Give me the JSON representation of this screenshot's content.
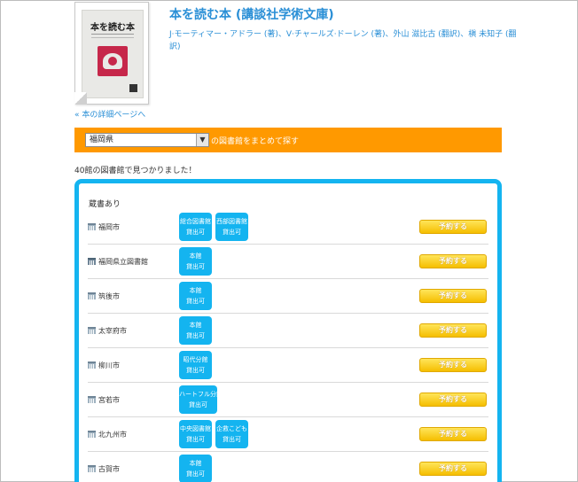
{
  "book": {
    "title": "本を読む本 (講談社学術文庫)",
    "authors": "J·モーティマー・アドラー (著)、V·チャールズ·ドーレン (著)、外山 滋比古 (翻訳)、槇 未知子 (翻訳)",
    "detail_link": "« 本の詳細ページへ",
    "cover_title": "本を読む本"
  },
  "prefecture": {
    "selected": "福岡県",
    "caption": "の図書館をまとめて探す"
  },
  "result_message": "40館の図書館で見つかりました！",
  "list": {
    "heading": "蔵書あり",
    "reserve_label": "予約する",
    "libraries": [
      {
        "name": "福岡市",
        "branches": [
          {
            "name": "総合図書館",
            "status": "貸出可"
          },
          {
            "name": "西部図書館",
            "status": "貸出可"
          }
        ]
      },
      {
        "name": "福岡県立図書館",
        "branches": [
          {
            "name": "本館",
            "status": "貸出可"
          }
        ]
      },
      {
        "name": "筑後市",
        "branches": [
          {
            "name": "本館",
            "status": "貸出可"
          }
        ]
      },
      {
        "name": "太宰府市",
        "branches": [
          {
            "name": "本館",
            "status": "貸出可"
          }
        ]
      },
      {
        "name": "柳川市",
        "branches": [
          {
            "name": "昭代分館",
            "status": "貸出可"
          }
        ]
      },
      {
        "name": "宮若市",
        "branches": [
          {
            "name": "ハートフル分館",
            "status": "貸出可"
          }
        ]
      },
      {
        "name": "北九州市",
        "branches": [
          {
            "name": "中央図書館",
            "status": "貸出可"
          },
          {
            "name": "企救こども",
            "status": "貸出可"
          }
        ]
      },
      {
        "name": "古賀市",
        "branches": [
          {
            "name": "本館",
            "status": "貸出可"
          }
        ]
      }
    ]
  },
  "colors": {
    "accent": "#2a8fd6",
    "bar": "#ff9900",
    "box": "#14b4f0",
    "button": "#f5be00"
  }
}
